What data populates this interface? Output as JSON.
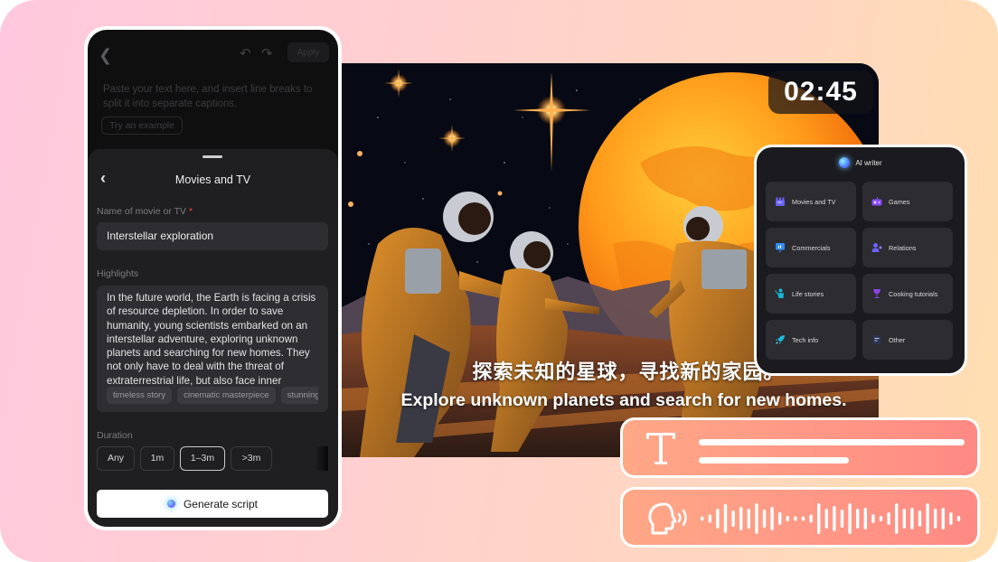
{
  "scene": {
    "timer": "02:45",
    "caption_cn": "探索未知的星球，寻找新的家园。",
    "caption_en": "Explore unknown planets and search for new homes."
  },
  "phone": {
    "top_bar": {
      "back_icon": "chevron-left-icon",
      "undo_icon": "undo-icon",
      "redo_icon": "redo-icon",
      "apply_label": "Apply"
    },
    "editor": {
      "placeholder": "Paste your text here, and insert line breaks to split it into separate captions.",
      "try_example_label": "Try an example"
    },
    "sheet": {
      "title": "Movies and TV",
      "name_label": "Name of movie or TV",
      "required_mark": "*",
      "name_value": "Interstellar exploration",
      "highlights_label": "Highlights",
      "highlights_text": "In the future world, the Earth is facing a crisis of resource depletion. In order to save humanity, young scientists embarked on an interstellar adventure, exploring unknown planets and searching for new homes. They not only have to deal with the threat of extraterrestrial life, but also face inner",
      "tags": [
        "timeless story",
        "cinematic masterpiece",
        "stunning v"
      ],
      "duration_label": "Duration",
      "durations": [
        {
          "label": "Any",
          "selected": false
        },
        {
          "label": "1m",
          "selected": false
        },
        {
          "label": "1–3m",
          "selected": true
        },
        {
          "label": ">3m",
          "selected": false
        }
      ],
      "generate_label": "Generate script"
    }
  },
  "ai_writer": {
    "title": "AI writer",
    "categories": [
      {
        "label": "Movies and TV",
        "icon": "clapperboard-icon",
        "color": "#6b63ff"
      },
      {
        "label": "Games",
        "icon": "gamepad-icon",
        "color": "#8b4dff"
      },
      {
        "label": "Commercials",
        "icon": "billboard-icon",
        "color": "#2f8cff"
      },
      {
        "label": "Relations",
        "icon": "people-icon",
        "color": "#6a63ff"
      },
      {
        "label": "Life stories",
        "icon": "person-waving-icon",
        "color": "#17b6d6"
      },
      {
        "label": "Cooking tutorials",
        "icon": "wine-glass-icon",
        "color": "#8a45e6"
      },
      {
        "label": "Tech info",
        "icon": "rocket-icon",
        "color": "#1fb9e0"
      },
      {
        "label": "Other",
        "icon": "document-icon",
        "color": "#2e3350"
      }
    ]
  },
  "pills": {
    "text_icon": "text-icon",
    "voice_icon": "speaking-head-icon"
  },
  "colors": {
    "accent_pink": "#ffc8de",
    "accent_peach": "#ffdfb0",
    "pill_start": "#ffa886",
    "pill_end": "#ff8a84",
    "sheet_bg": "#1f1f22",
    "required": "#ff3b30"
  }
}
